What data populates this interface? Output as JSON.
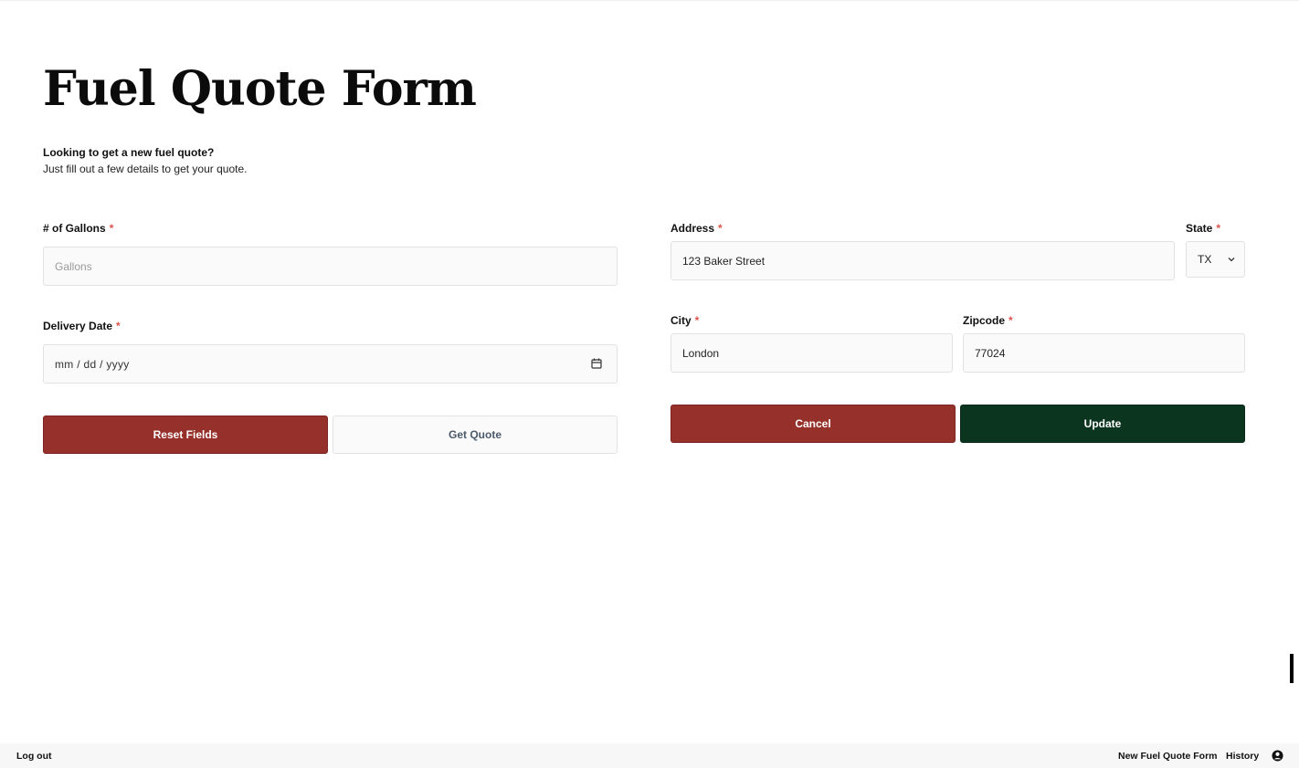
{
  "page": {
    "title": "Fuel Quote Form",
    "intro_heading": "Looking to get a new fuel quote?",
    "intro_text": "Just fill out a few details to get your quote."
  },
  "form": {
    "gallons": {
      "label": "# of Gallons",
      "required": "*",
      "placeholder": "Gallons",
      "value": ""
    },
    "delivery_date": {
      "label": "Delivery Date",
      "required": "*",
      "placeholder": "mm / dd / yyyy",
      "icon": "calendar-icon"
    },
    "reset_label": "Reset Fields",
    "get_quote_label": "Get Quote"
  },
  "address": {
    "address": {
      "label": "Address",
      "required": "*",
      "value": "123 Baker Street"
    },
    "state": {
      "label": "State",
      "required": "*",
      "value": "TX",
      "icon": "chevron-down-icon"
    },
    "city": {
      "label": "City",
      "required": "*",
      "value": "London"
    },
    "zipcode": {
      "label": "Zipcode",
      "required": "*",
      "value": "77024"
    },
    "cancel_label": "Cancel",
    "update_label": "Update"
  },
  "footer": {
    "logout": "Log out",
    "nav_new": "New Fuel Quote Form",
    "nav_history": "History",
    "user_icon": "user-circle-icon"
  },
  "colors": {
    "primary_red": "#96302a",
    "primary_green": "#0c3520",
    "required_marker": "#e0524b",
    "input_bg": "#fafafa"
  }
}
